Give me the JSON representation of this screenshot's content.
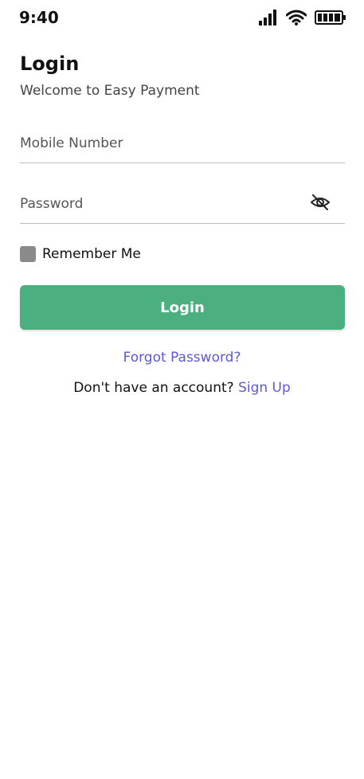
{
  "status_bar": {
    "time": "9:40",
    "icons": [
      "cellular-signal-icon",
      "wifi-icon",
      "battery-icon"
    ]
  },
  "header": {
    "title": "Login",
    "subtitle": "Welcome to Easy Payment"
  },
  "form": {
    "mobile_placeholder": "Mobile Number",
    "mobile_value": "",
    "password_placeholder": "Password",
    "password_value": "",
    "password_toggle_icon": "eye-off-icon",
    "remember_label": "Remember Me",
    "remember_checked": false,
    "login_label": "Login"
  },
  "links": {
    "forgot_password": "Forgot Password?",
    "no_account_text": "Don't have an account? ",
    "sign_up": "Sign Up"
  },
  "colors": {
    "primary_button": "#4caf80",
    "link": "#5b5bd6",
    "checkbox": "#8a8a8a"
  }
}
